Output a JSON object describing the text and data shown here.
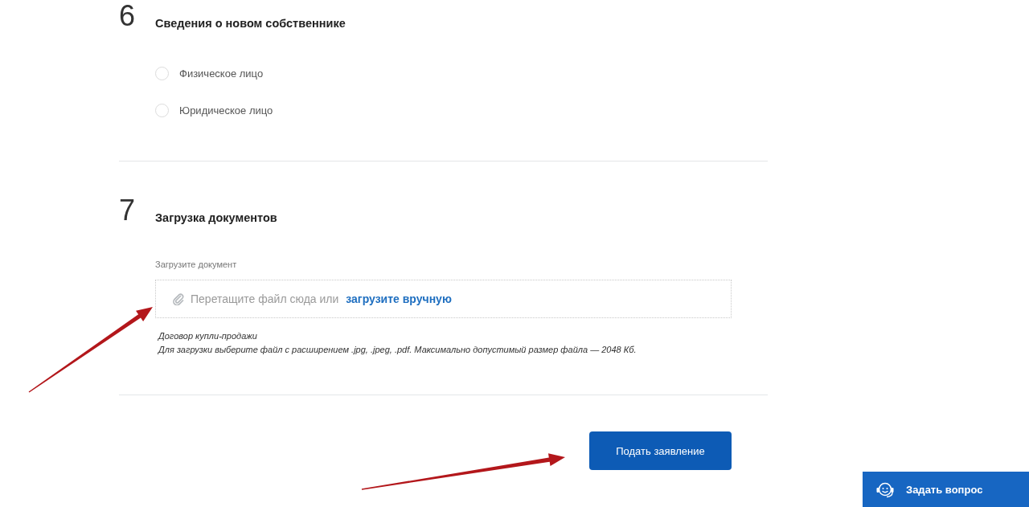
{
  "sections": [
    {
      "number": "6",
      "title": "Сведения о новом собственнике",
      "kind": "radio",
      "options": [
        {
          "label": "Физическое лицо",
          "selected": false
        },
        {
          "label": "Юридическое лицо",
          "selected": false
        }
      ]
    },
    {
      "number": "7",
      "title": "Загрузка документов",
      "kind": "upload",
      "upload": {
        "label": "Загрузите документ",
        "prompt": "Перетащите файл сюда или",
        "link": "загрузите вручную",
        "notes": [
          "Договор купли-продажи",
          "Для загрузки выберите файл с расширением .jpg, .jpeg, .pdf. Максимально допустимый размер файла — 2048 Кб."
        ]
      }
    }
  ],
  "submit_button": "Подать заявление",
  "help_button": "Задать вопрос"
}
